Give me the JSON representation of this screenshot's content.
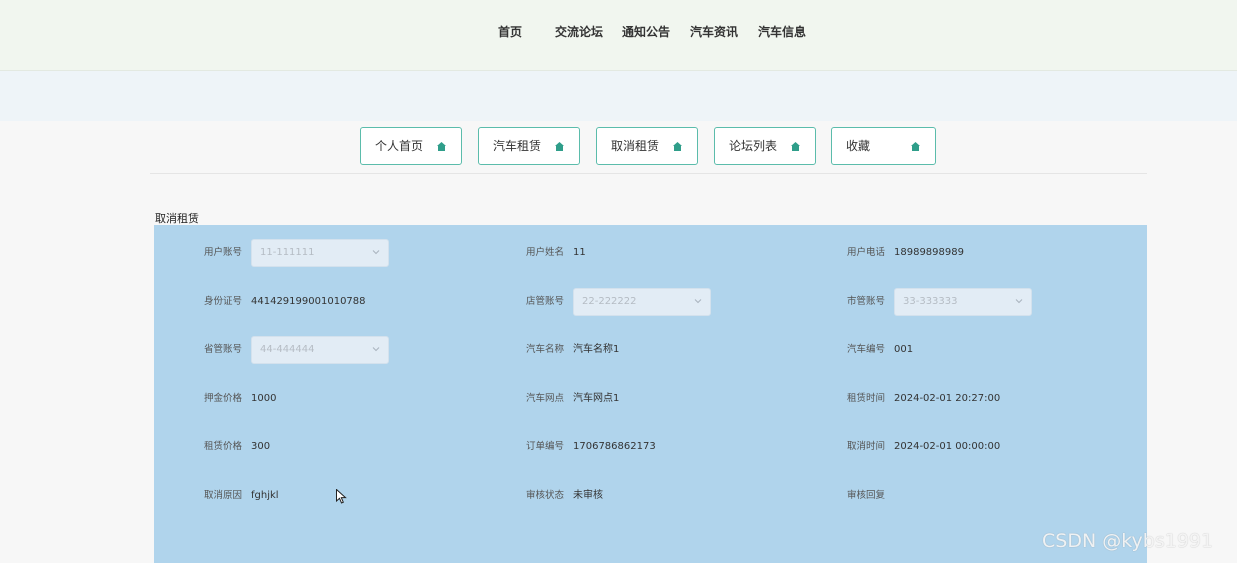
{
  "nav": [
    "首页",
    "交流论坛",
    "通知公告",
    "汽车资讯",
    "汽车信息"
  ],
  "tabs": [
    "个人首页",
    "汽车租赁",
    "取消租赁",
    "论坛列表",
    "收藏"
  ],
  "section_title": "取消租赁",
  "form": {
    "user_account": {
      "label": "用户账号",
      "value": "11-111111"
    },
    "user_name": {
      "label": "用户姓名",
      "value": "11"
    },
    "user_phone": {
      "label": "用户电话",
      "value": "18989898989"
    },
    "id_card": {
      "label": "身份证号",
      "value": "441429199001010788"
    },
    "store_account": {
      "label": "店管账号",
      "value": "22-222222"
    },
    "city_account": {
      "label": "市管账号",
      "value": "33-333333"
    },
    "province_account": {
      "label": "省管账号",
      "value": "44-444444"
    },
    "car_name": {
      "label": "汽车名称",
      "value": "汽车名称1"
    },
    "car_no": {
      "label": "汽车编号",
      "value": "001"
    },
    "deposit": {
      "label": "押金价格",
      "value": "1000"
    },
    "car_outlet": {
      "label": "汽车网点",
      "value": "汽车网点1"
    },
    "rent_time": {
      "label": "租赁时间",
      "value": "2024-02-01 20:27:00"
    },
    "rent_price": {
      "label": "租赁价格",
      "value": "300"
    },
    "order_no": {
      "label": "订单编号",
      "value": "1706786862173"
    },
    "cancel_time": {
      "label": "取消时间",
      "value": "2024-02-01 00:00:00"
    },
    "cancel_reason": {
      "label": "取消原因",
      "value": "fghjkl"
    },
    "review_status": {
      "label": "审核状态",
      "value": "未审核"
    },
    "review_reply": {
      "label": "审核回复",
      "value": ""
    }
  },
  "colors": {
    "accent": "#5bbcab",
    "panel": "#b0d4ec",
    "header": "#f1f6ef"
  },
  "watermark": "CSDN @kybs1991"
}
